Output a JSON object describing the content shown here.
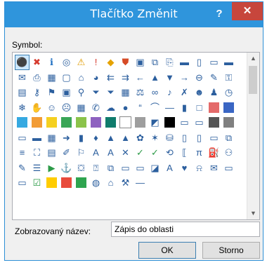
{
  "dialog": {
    "title": "Tlačítko Změnit",
    "help_label": "?",
    "close_label": "✕",
    "symbol_label": "Symbol:",
    "display_name_label": "Zobrazovaný název:",
    "display_name_value": "Zápis do oblasti",
    "ok_label": "OK",
    "cancel_label": "Storno"
  },
  "icons": [
    [
      "symbol-network-icon",
      "⚫"
    ],
    [
      "symbol-error-icon",
      "✖"
    ],
    [
      "symbol-info-icon",
      "ℹ"
    ],
    [
      "symbol-target-icon",
      "◎"
    ],
    [
      "symbol-warning-icon",
      "⚠"
    ],
    [
      "symbol-exclamation-icon",
      "!"
    ],
    [
      "symbol-alert-icon",
      "◆"
    ],
    [
      "symbol-shield-icon",
      "⛊"
    ],
    [
      "symbol-save-icon",
      "▣"
    ],
    [
      "symbol-copy-icon",
      "⧉"
    ],
    [
      "symbol-new-icon",
      "⎘"
    ],
    [
      "symbol-folder-icon",
      "▬"
    ],
    [
      "symbol-page-icon",
      "▯"
    ],
    [
      "",
      ""
    ],
    [
      "",
      ""
    ],
    [
      "symbol-open-folder-icon",
      "▭"
    ],
    [
      "symbol-folders-icon",
      "▬"
    ],
    [
      "symbol-mail-icon",
      "✉"
    ],
    [
      "symbol-print-icon",
      "⎙"
    ],
    [
      "symbol-calendar-icon",
      "▦"
    ],
    [
      "symbol-window-icon",
      "▢"
    ],
    [
      "symbol-home-icon",
      "⌂"
    ],
    [
      "symbol-pie-icon",
      "◕"
    ],
    [
      "symbol-back2-icon",
      "⇇"
    ],
    [
      "symbol-fwd2-icon",
      "⇉"
    ],
    [
      "symbol-back-icon",
      "←"
    ],
    [
      "symbol-up-icon",
      "▲"
    ],
    [
      "symbol-down-icon",
      "▼"
    ],
    [
      "",
      ""
    ],
    [
      "",
      ""
    ],
    [
      "symbol-right-arrow-icon",
      "→"
    ],
    [
      "symbol-circle-left-icon",
      "⊖"
    ],
    [
      "symbol-pin-icon",
      "✎"
    ],
    [
      "symbol-lock-icon",
      "⚿"
    ],
    [
      "symbol-paste-icon",
      "▤"
    ],
    [
      "symbol-key-icon",
      "⚷"
    ],
    [
      "symbol-flag-icon",
      "⚑"
    ],
    [
      "symbol-form-icon",
      "▣"
    ],
    [
      "symbol-search-icon",
      "⚲"
    ],
    [
      "symbol-filter-icon",
      "⏷"
    ],
    [
      "symbol-filter2-icon",
      "⏷"
    ],
    [
      "symbol-table-icon",
      "▦"
    ],
    [
      "symbol-scale-icon",
      "⚖"
    ],
    [
      "",
      ""
    ],
    [
      "",
      ""
    ],
    [
      "symbol-rings-icon",
      "∞"
    ],
    [
      "symbol-mic-icon",
      "♪"
    ],
    [
      "symbol-no-user-icon",
      "✗"
    ],
    [
      "symbol-user-icon",
      "☻"
    ],
    [
      "symbol-group-icon",
      "♟"
    ],
    [
      "symbol-clock-icon",
      "◷"
    ],
    [
      "symbol-snow-icon",
      "❄"
    ],
    [
      "symbol-hand-icon",
      "✋"
    ],
    [
      "symbol-smile-icon",
      "☺"
    ],
    [
      "symbol-sad-icon",
      "☹"
    ],
    [
      "symbol-grid-icon",
      "▦"
    ],
    [
      "symbol-phone-icon",
      "✆"
    ],
    [
      "symbol-bubble-icon",
      "☁"
    ],
    [
      "",
      ""
    ],
    [
      "",
      ""
    ],
    [
      "symbol-ball-icon",
      "●"
    ],
    [
      "symbol-quote-icon",
      "“"
    ],
    [
      "symbol-wave-icon",
      "⌒"
    ],
    [
      "symbol-dash-icon",
      "—"
    ],
    [
      "symbol-vert-bars-icon",
      "▮"
    ],
    [
      "symbol-outline-square-icon",
      "□"
    ],
    [
      "swatch-red-icon",
      "#e46a6a"
    ],
    [
      "swatch-blue-icon",
      "#3a66c4"
    ],
    [
      "swatch-cyan-icon",
      "#36a9e1"
    ],
    [
      "swatch-orange-icon",
      "#f29c36"
    ],
    [
      "swatch-yellow-icon",
      "#f5d020"
    ],
    [
      "swatch-green-icon",
      "#3aa657"
    ],
    [
      "swatch-olive-icon",
      "#8bc34a"
    ],
    [
      "",
      ""
    ],
    [
      "",
      ""
    ],
    [
      "swatch-purple-icon",
      "#8e62c0"
    ],
    [
      "swatch-teal-icon",
      "#107c6c"
    ],
    [
      "swatch-white-icon",
      "#ffffff"
    ],
    [
      "swatch-gray-icon",
      "#9e9e9e"
    ],
    [
      "symbol-split-square-icon",
      "◩"
    ],
    [
      "swatch-black-icon",
      "#000000"
    ],
    [
      "symbol-box-icon",
      "▭"
    ],
    [
      "symbol-box2-icon",
      "▭"
    ],
    [
      "swatch-darkgray-icon",
      "#555555"
    ],
    [
      "swatch-gray2-icon",
      "#808080"
    ],
    [
      "symbol-box3-icon",
      "▭"
    ],
    [
      "symbol-stripe-icon",
      "▬"
    ],
    [
      "",
      ""
    ],
    [
      "",
      ""
    ],
    [
      "",
      ""
    ],
    [
      "symbol-qr-icon",
      "▦"
    ],
    [
      "symbol-circle-arrow-icon",
      "➜"
    ],
    [
      "symbol-bar-chart-icon",
      "▮"
    ],
    [
      "symbol-drop-icon",
      "♦"
    ],
    [
      "symbol-tree-icon",
      "▲"
    ],
    [
      "symbol-mountain-icon",
      "▲"
    ],
    [
      "symbol-flower-icon",
      "✿"
    ],
    [
      "symbol-star-icon",
      "✶"
    ],
    [
      "symbol-db-icon",
      "⛁"
    ],
    [
      "symbol-doc-purple-icon",
      "▯"
    ],
    [
      "symbol-doc-orange-icon",
      "▯"
    ],
    [
      "symbol-doc-icon",
      "▭"
    ],
    [
      "symbol-copy2-icon",
      "⧉"
    ],
    [
      "symbol-bars-icon",
      "≡"
    ],
    [
      "",
      ""
    ],
    [
      "symbol-bag-icon",
      "⛶"
    ],
    [
      "symbol-note-icon",
      "▤"
    ],
    [
      "symbol-paint-icon",
      "✐"
    ],
    [
      "symbol-flag2-icon",
      "⚐"
    ],
    [
      "symbol-text-a-icon",
      "A"
    ],
    [
      "symbol-text-a2-icon",
      "A"
    ],
    [
      "symbol-x-icon",
      "✕"
    ],
    [
      "symbol-check-icon",
      "✓"
    ],
    [
      "symbol-chart-check-icon",
      "✓"
    ],
    [
      "symbol-sync-icon",
      "⟲"
    ],
    [
      "symbol-bracket-icon",
      "⟦"
    ],
    [
      "symbol-pi-icon",
      "π"
    ],
    [
      "",
      ""
    ],
    [
      "",
      ""
    ],
    [
      "",
      ""
    ],
    [
      "symbol-bucket-icon",
      "⛽"
    ],
    [
      "symbol-binoculars-icon",
      "⚇"
    ],
    [
      "symbol-brush-icon",
      "✎"
    ],
    [
      "symbol-list-icon",
      "☰"
    ],
    [
      "symbol-play-icon",
      "▶"
    ],
    [
      "symbol-anchor-icon",
      "⚓"
    ],
    [
      "symbol-case-icon",
      "⛋"
    ],
    [
      "symbol-pointer-icon",
      "⍰"
    ],
    [
      "symbol-pages-icon",
      "⧉"
    ],
    [
      "symbol-doc2-icon",
      "▭"
    ],
    [
      "symbol-dash2-icon",
      "▭"
    ],
    [
      "symbol-eraser-icon",
      "◪"
    ],
    [
      "symbol-a-script-icon",
      "A"
    ],
    [
      "",
      ""
    ],
    [
      "",
      ""
    ],
    [
      "symbol-heart-colors-icon",
      "♥"
    ],
    [
      "symbol-bell-icon",
      "⍾"
    ],
    [
      "symbol-mail2-icon",
      "✉"
    ],
    [
      "symbol-picture-icon",
      "▭"
    ],
    [
      "symbol-form2-icon",
      "▭"
    ],
    [
      "symbol-checkbox-icon",
      "☑"
    ],
    [
      "swatch-yellow2-icon",
      "#ffcc00"
    ],
    [
      "swatch-red-hatch-icon",
      "#e84b3c"
    ],
    [
      "swatch-green2-icon",
      "#2ea44f"
    ],
    [
      "symbol-globe-icon",
      "◍"
    ],
    [
      "symbol-house-icon",
      "⌂"
    ],
    [
      "symbol-key2-icon",
      "⚒"
    ],
    [
      "symbol-line-icon",
      "—"
    ],
    [
      "",
      ""
    ],
    [
      "",
      ""
    ]
  ]
}
